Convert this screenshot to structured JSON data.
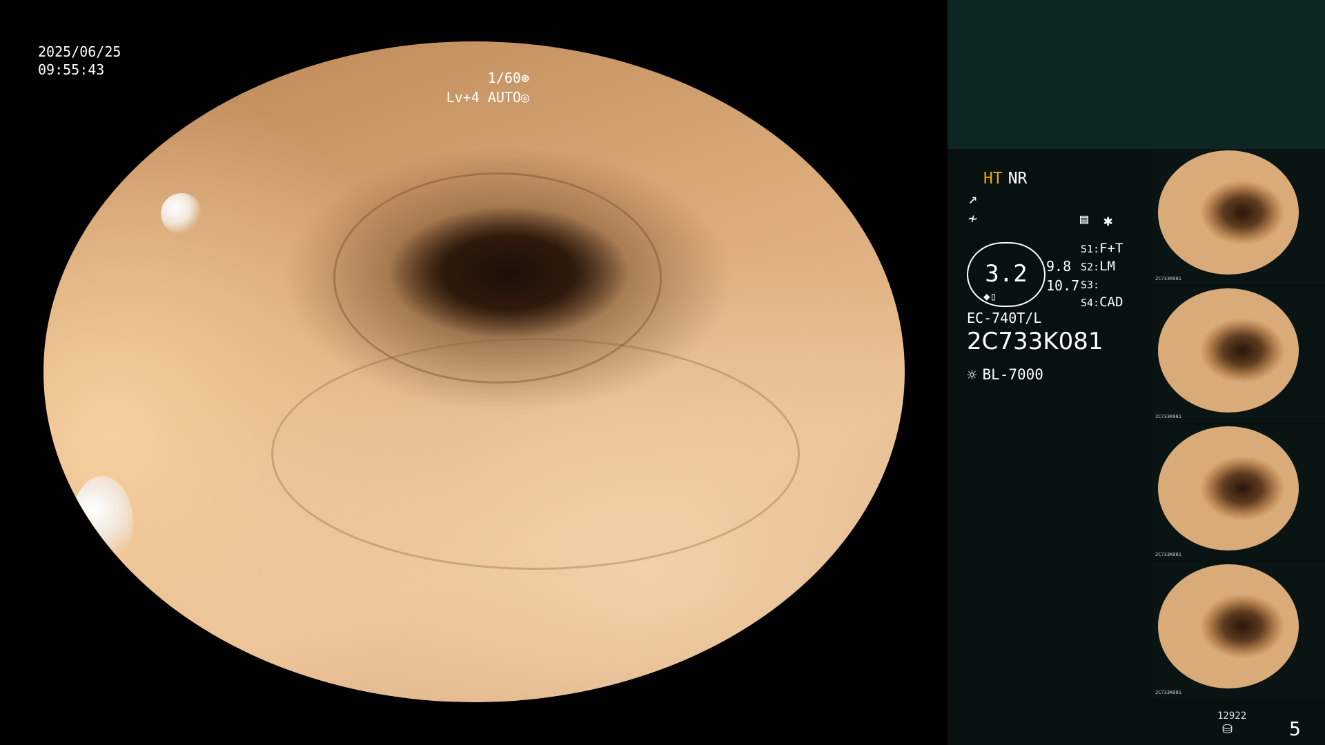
{
  "overlay": {
    "date": "2025/06/25",
    "time": "09:55:43",
    "shutter": "1/60",
    "shutter_icon": "aperture-icon",
    "light_level": "Lv+4 AUTO",
    "light_icon": "auto-light-icon"
  },
  "panel": {
    "ht_label": "HT",
    "nr_label": "NR",
    "ht_color": "#f0a800",
    "magnification": "3.2",
    "zoom_values": [
      "9.8",
      "10.7"
    ],
    "switches": [
      {
        "label": "S1:",
        "value": "F+T"
      },
      {
        "label": "S2:",
        "value": "LM"
      },
      {
        "label": "S3:",
        "value": ""
      },
      {
        "label": "S4:",
        "value": "CAD"
      }
    ],
    "scope_model": "EC-740T/L",
    "scope_serial": "2C733K081",
    "light_source": "BL-7000",
    "counter": "12922",
    "page_number": "5"
  },
  "thumbnails": [
    {
      "label": "2C733K081"
    },
    {
      "label": "2C733K081"
    },
    {
      "label": "2C733K081"
    },
    {
      "label": "2C733K081"
    }
  ]
}
